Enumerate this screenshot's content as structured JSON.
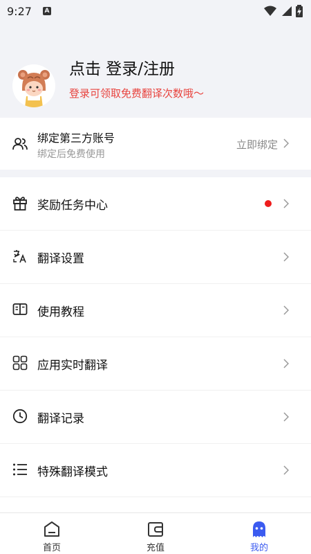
{
  "status_bar": {
    "time": "9:27",
    "keyboard_indicator": "A",
    "icons": [
      "wifi-icon",
      "signal-icon",
      "battery-charging-icon"
    ]
  },
  "profile": {
    "title": "点击 登录/注册",
    "subtitle": "登录可领取免费翻译次数哦～",
    "avatar_icon": "bear-avatar-icon"
  },
  "bind_account": {
    "title": "绑定第三方账号",
    "subtitle": "绑定后免费使用",
    "action": "立即绑定",
    "icon": "users-icon"
  },
  "menu": {
    "items": [
      {
        "label": "奖励任务中心",
        "icon": "gift-icon",
        "badge": true
      },
      {
        "label": "翻译设置",
        "icon": "translate-icon",
        "badge": false
      },
      {
        "label": "使用教程",
        "icon": "book-icon",
        "badge": false
      },
      {
        "label": "应用实时翻译",
        "icon": "apps-grid-icon",
        "badge": false
      },
      {
        "label": "翻译记录",
        "icon": "clock-icon",
        "badge": false
      },
      {
        "label": "特殊翻译模式",
        "icon": "list-icon",
        "badge": false
      }
    ]
  },
  "tab_bar": {
    "tabs": [
      {
        "label": "首页",
        "icon": "home-icon",
        "active": false
      },
      {
        "label": "充值",
        "icon": "wallet-icon",
        "active": false
      },
      {
        "label": "我的",
        "icon": "profile-icon",
        "active": true
      }
    ]
  },
  "colors": {
    "accent": "#3b5bf0",
    "promo_red": "#e8433e",
    "badge_red": "#ee1c1c",
    "page_bg": "#f2f3f7"
  }
}
